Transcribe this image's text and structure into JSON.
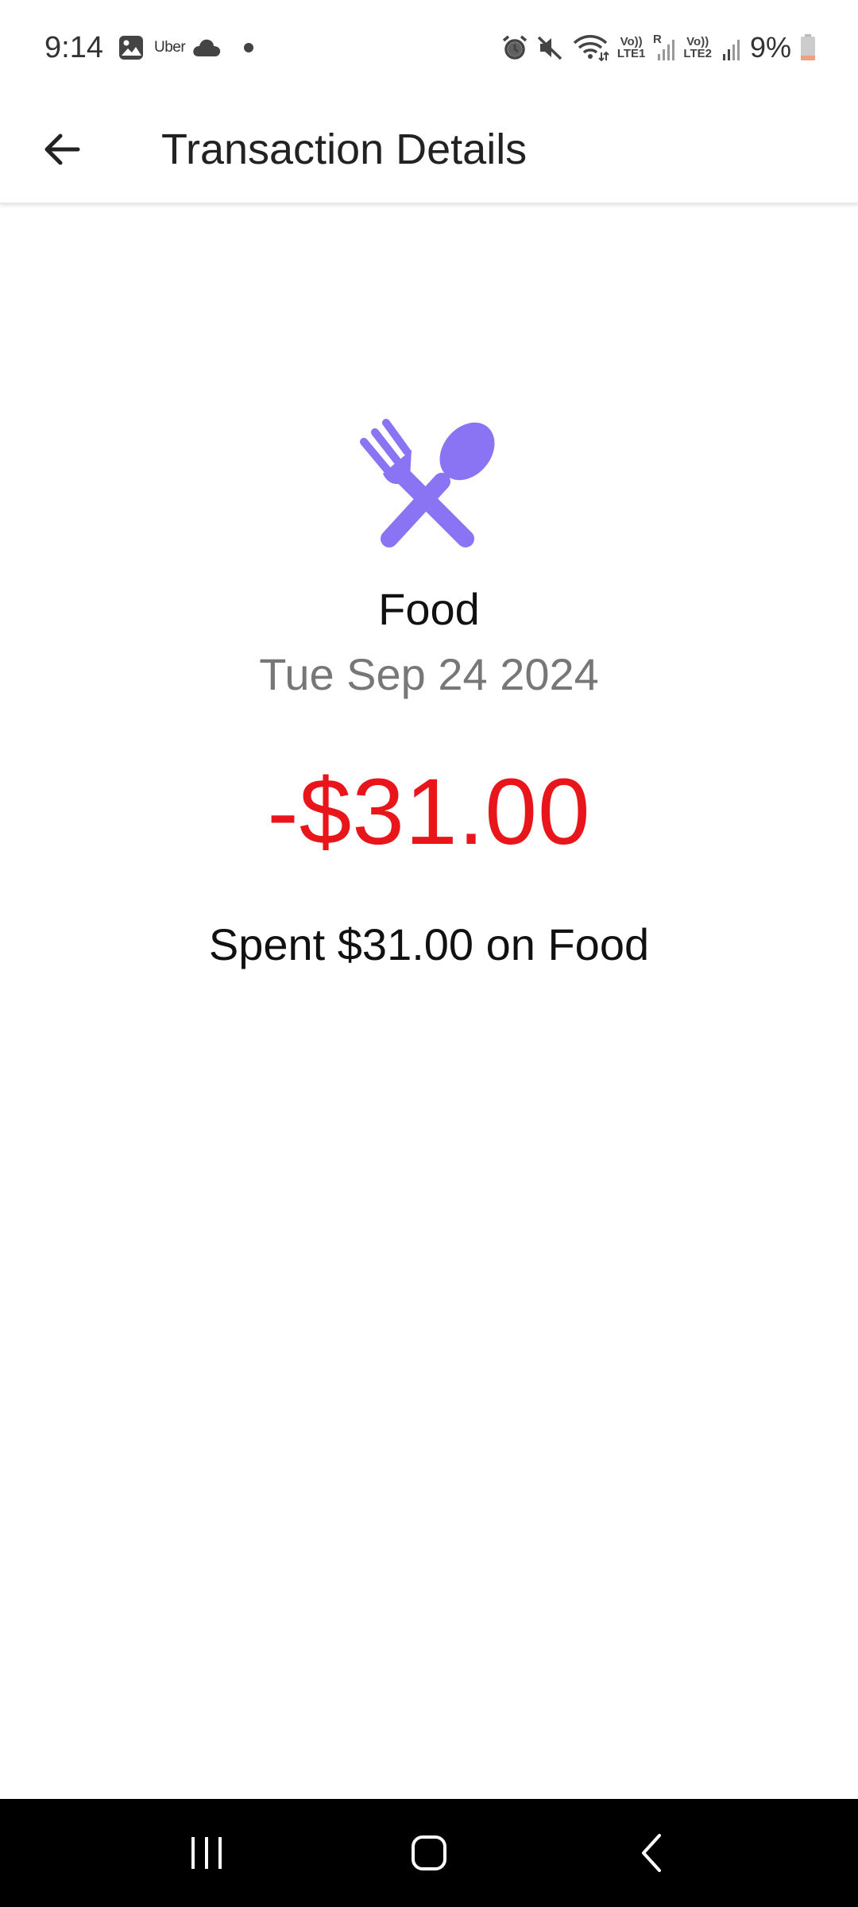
{
  "status_bar": {
    "time": "9:14",
    "notification_app": "Uber",
    "net1": [
      "Vo))",
      "LTE1"
    ],
    "roaming": "R",
    "net2": [
      "Vo))",
      "LTE2"
    ],
    "battery": "9%"
  },
  "toolbar": {
    "title": "Transaction Details"
  },
  "transaction": {
    "category_icon": "fork-spoon-icon",
    "category_icon_color": "#8b74f4",
    "category": "Food",
    "date": "Tue Sep 24 2024",
    "amount": "-$31.00",
    "amount_color": "#e8151b",
    "description": "Spent $31.00 on Food"
  },
  "nav_bar": {
    "icons": [
      "recent-apps-icon",
      "home-icon",
      "back-nav-icon"
    ]
  }
}
